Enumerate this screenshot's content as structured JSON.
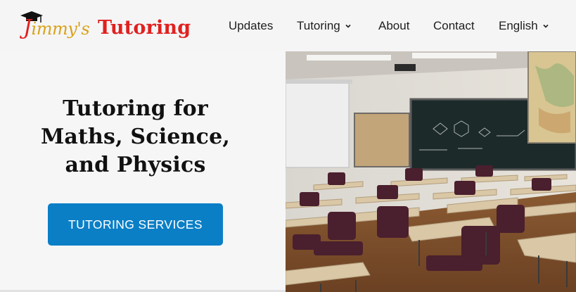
{
  "brand": {
    "script_text_j": "J",
    "script_text_rest": "immy's",
    "main_text": "Tutoring"
  },
  "nav": {
    "updates": "Updates",
    "tutoring": "Tutoring",
    "about": "About",
    "contact": "Contact",
    "language": "English"
  },
  "hero": {
    "title_line1": "Tutoring for",
    "title_line2": "Maths, Science,",
    "title_line3": "and Physics",
    "cta_label": "TUTORING SERVICES"
  },
  "colors": {
    "brand_red": "#e0211f",
    "brand_gold": "#d8a21a",
    "cta_blue": "#0a7fc6",
    "chalkboard": "#1d2a2a",
    "desk_top": "#d9c7a6",
    "chair": "#4a1f2e"
  },
  "icons": {
    "logo_cap": "graduation-cap-icon",
    "dropdown": "chevron-down-icon"
  }
}
